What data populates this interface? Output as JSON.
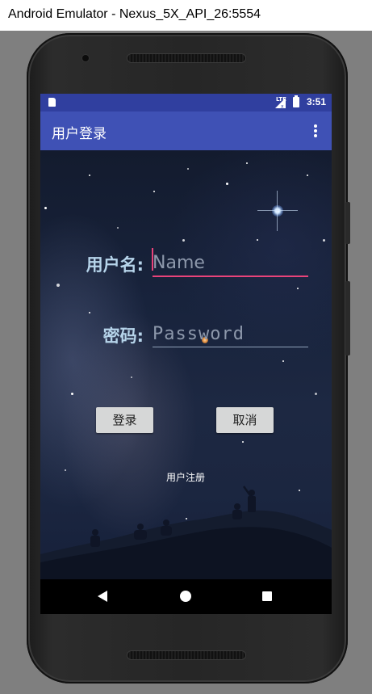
{
  "window": {
    "title": "Android Emulator - Nexus_5X_API_26:5554"
  },
  "status_bar": {
    "network": "LTE",
    "time": "3:51"
  },
  "app_bar": {
    "title": "用户登录",
    "menu_icon": "overflow-menu-icon"
  },
  "form": {
    "username_label": "用户名:",
    "username_placeholder": "Name",
    "username_value": "",
    "password_label": "密码:",
    "password_placeholder": "Password",
    "password_value": ""
  },
  "buttons": {
    "login": "登录",
    "cancel": "取消"
  },
  "register_link": "用户注册",
  "nav_bar": {
    "icons": [
      "back-icon",
      "home-icon",
      "recents-icon"
    ]
  },
  "colors": {
    "status_bar": "#303f9f",
    "app_bar": "#3f51b5",
    "accent": "#e9437a",
    "label": "#b6d4ea"
  }
}
